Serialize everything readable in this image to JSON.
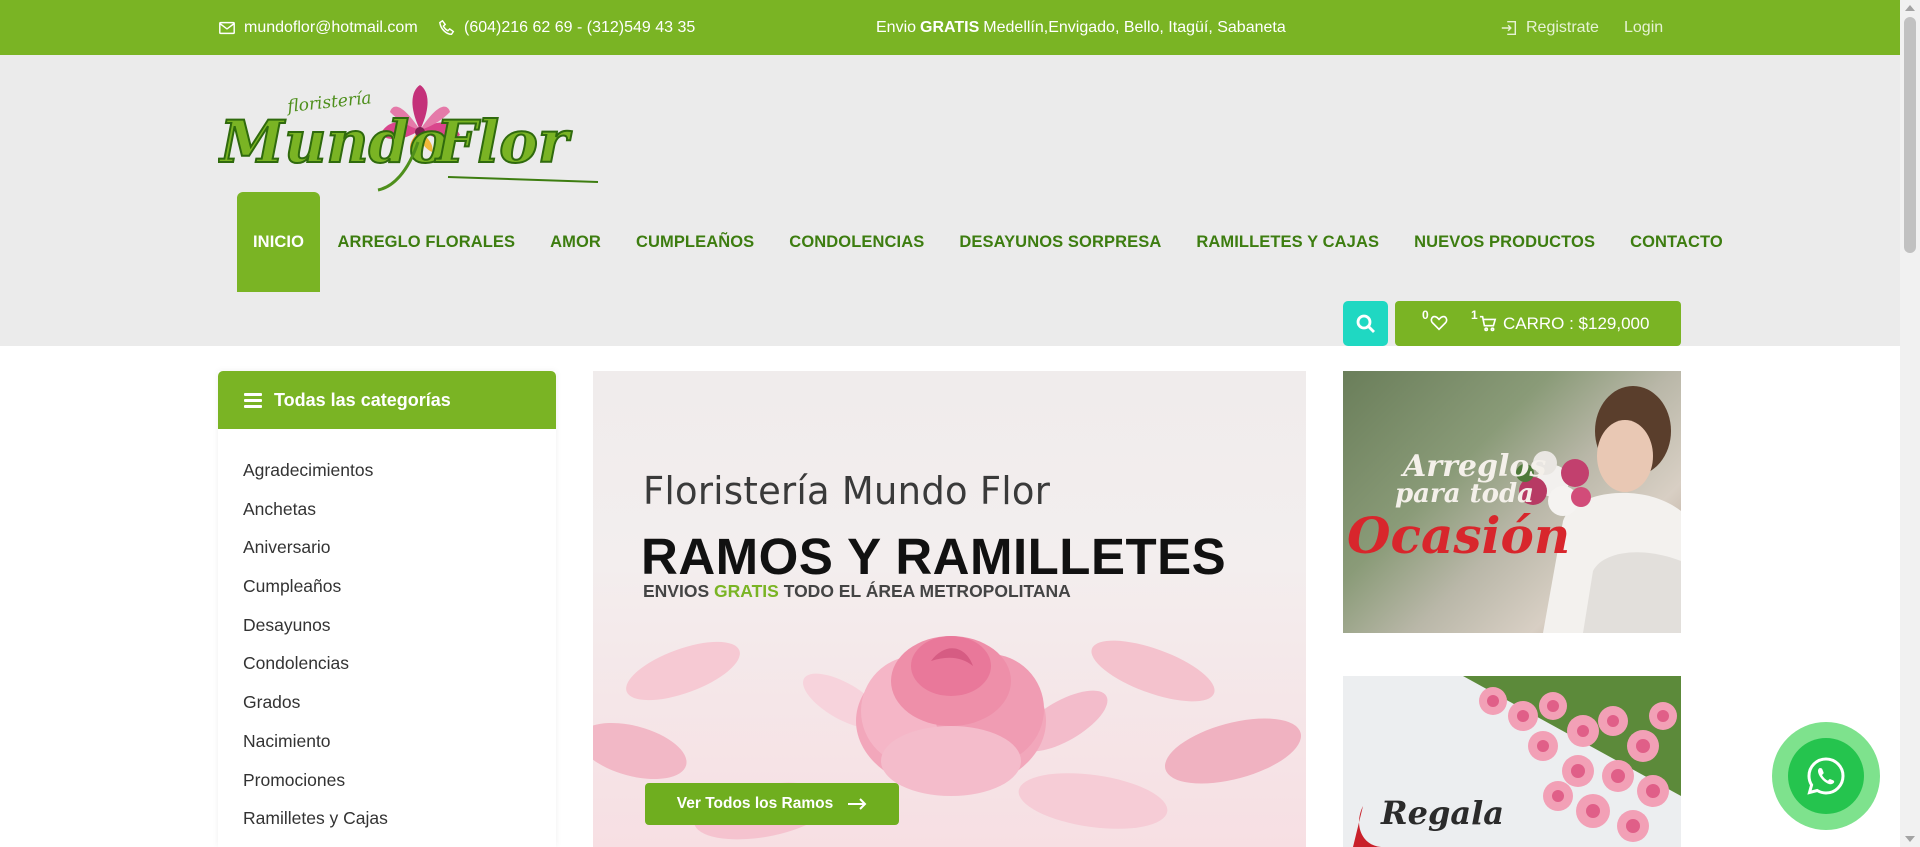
{
  "topbar": {
    "email": "mundoflor@hotmail.com",
    "phone": "(604)216 62 69 - (312)549 43 35",
    "shipping_prefix": "Envio",
    "shipping_bold": "GRATIS",
    "shipping_areas": "Medellín,Envigado, Bello, Itagüí, Sabaneta",
    "register_label": "Registrate",
    "login_label": "Login",
    "icons": [
      "mail-icon",
      "phone-icon",
      "sign-in-icon"
    ]
  },
  "logo": {
    "small_text": "floristería",
    "brand_text": "Mundo Flor"
  },
  "nav": {
    "items": [
      {
        "label": "INICIO"
      },
      {
        "label": "ARREGLO FLORALES"
      },
      {
        "label": "AMOR"
      },
      {
        "label": "CUMPLEAÑOS"
      },
      {
        "label": "CONDOLENCIAS"
      },
      {
        "label": "DESAYUNOS SORPRESA"
      },
      {
        "label": "RAMILLETES Y CAJAS"
      },
      {
        "label": "NUEVOS PRODUCTOS"
      },
      {
        "label": "CONTACTO"
      }
    ],
    "active_index": 0
  },
  "cart": {
    "wishlist_count": "0",
    "cart_count": "1",
    "total_label": "CARRO : $129,000"
  },
  "sidebar": {
    "title": "Todas las categorías",
    "categories": [
      {
        "label": "Agradecimientos"
      },
      {
        "label": "Anchetas"
      },
      {
        "label": "Aniversario"
      },
      {
        "label": "Cumpleaños"
      },
      {
        "label": "Desayunos"
      },
      {
        "label": "Condolencias"
      },
      {
        "label": "Grados"
      },
      {
        "label": "Nacimiento"
      },
      {
        "label": "Promociones"
      },
      {
        "label": "Ramilletes y Cajas"
      }
    ]
  },
  "banner": {
    "subtitle": "Floristería Mundo Flor",
    "title": "RAMOS Y RAMILLETES",
    "tagline_pre": "ENVIOS ",
    "tagline_hl": "GRATIS",
    "tagline_post": " TODO EL ÁREA METROPOLITANA",
    "cta_label": "Ver Todos los Ramos"
  },
  "promos": {
    "promo1_line1": "Arreglos",
    "promo1_line2": "para toda",
    "promo1_line3": "Ocasión",
    "promo2_line1": "Regala"
  },
  "colors": {
    "brand_green": "#7ab424",
    "nav_text": "#3d7d10",
    "search_teal": "#1fd8c2",
    "whatsapp": "#25c44e"
  }
}
